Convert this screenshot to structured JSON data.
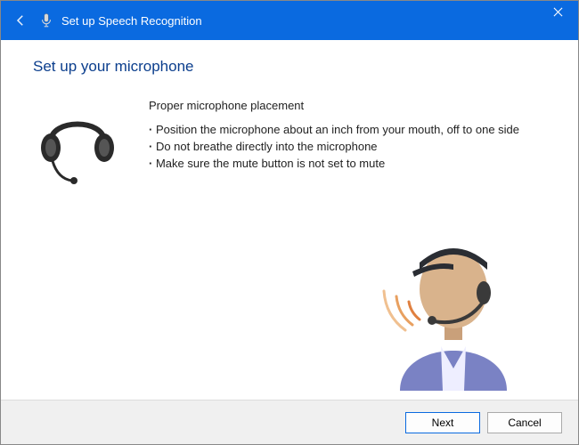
{
  "titlebar": {
    "title": "Set up Speech Recognition"
  },
  "heading": "Set up your microphone",
  "instructions": {
    "subtitle": "Proper microphone placement",
    "bullets": [
      "Position the microphone about an inch from your mouth, off to one side",
      "Do not breathe directly into the microphone",
      "Make sure the mute button is not set to mute"
    ]
  },
  "footer": {
    "next_label": "Next",
    "cancel_label": "Cancel"
  }
}
